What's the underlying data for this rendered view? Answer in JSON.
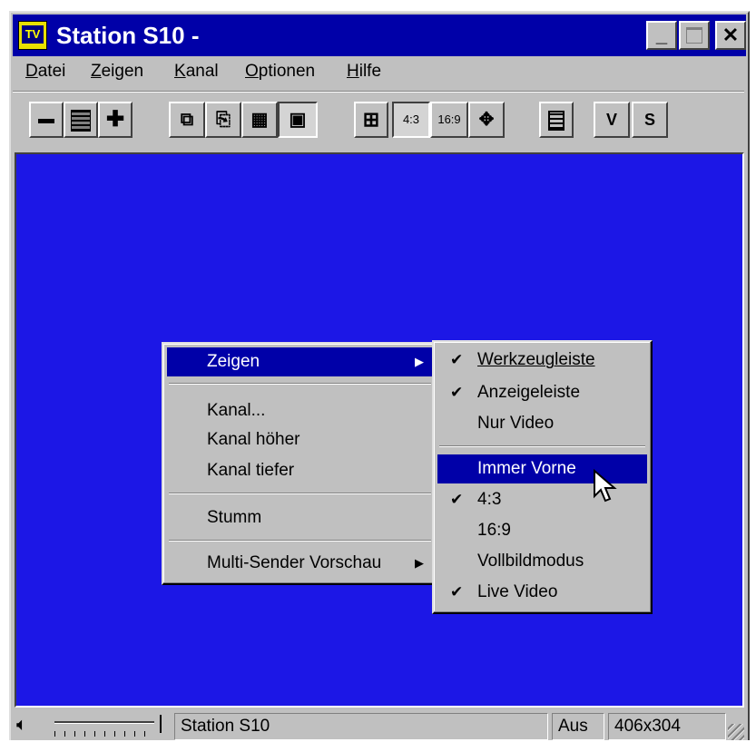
{
  "window": {
    "title": "Station S10 -",
    "app_icon_text": "TV"
  },
  "title_buttons": {
    "minimize": "_",
    "maximize": "",
    "close": "✕"
  },
  "menubar": [
    {
      "label": "Datei",
      "accel": "D"
    },
    {
      "label": "Zeigen",
      "accel": "Z"
    },
    {
      "label": "Kanal",
      "accel": "K"
    },
    {
      "label": "Optionen",
      "accel": "O"
    },
    {
      "label": "Hilfe",
      "accel": "H"
    }
  ],
  "toolbar": {
    "ratio_43": "4:3",
    "ratio_169": "16:9",
    "v": "V",
    "s": "S"
  },
  "context_menu": {
    "zeigen": "Zeigen",
    "kanal": "Kanal...",
    "kanal_hoeher": "Kanal höher",
    "kanal_tiefer": "Kanal tiefer",
    "stumm": "Stumm",
    "multi": "Multi-Sender Vorschau"
  },
  "submenu": {
    "werkzeugleiste": "Werkzeugleiste",
    "anzeigeleiste": "Anzeigeleiste",
    "nur_video": "Nur Video",
    "immer_vorne": "Immer Vorne",
    "r43": "4:3",
    "r169": "16:9",
    "vollbild": "Vollbildmodus",
    "live_video": "Live Video",
    "checked": [
      "Werkzeugleiste",
      "Anzeigeleiste",
      "4:3",
      "Live Video"
    ]
  },
  "statusbar": {
    "station": "Station S10",
    "mute": "Aus",
    "resolution": "406x304"
  },
  "colors": {
    "video_bg": "#1c17e6",
    "titlebar": "#0000a8",
    "highlight": "#0000a8"
  }
}
